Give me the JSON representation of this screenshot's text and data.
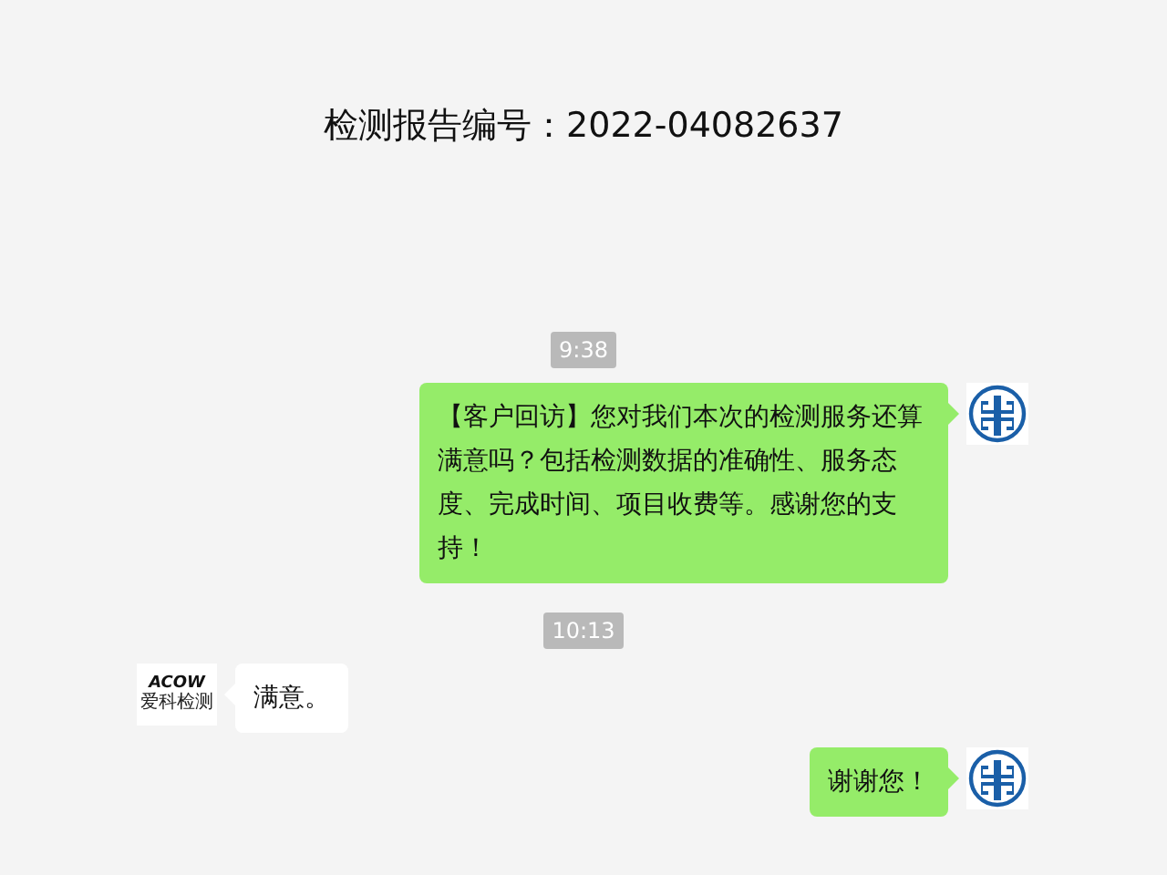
{
  "title": "检测报告编号：2022-04082637",
  "messages": [
    {
      "kind": "time",
      "text": "9:38"
    },
    {
      "kind": "outgoing",
      "avatar": {
        "kind": "emblem"
      },
      "text": "【客户回访】您对我们本次的检测服务还算满意吗？包括检测数据的准确性、服务态度、完成时间、项目收费等。感谢您的支持！"
    },
    {
      "kind": "time",
      "text": "10:13"
    },
    {
      "kind": "incoming",
      "avatar": {
        "kind": "logo",
        "brand": "ACOW",
        "caption": "爱科检测"
      },
      "text": "满意。"
    },
    {
      "kind": "outgoing",
      "avatar": {
        "kind": "emblem"
      },
      "text": "谢谢您！"
    }
  ]
}
